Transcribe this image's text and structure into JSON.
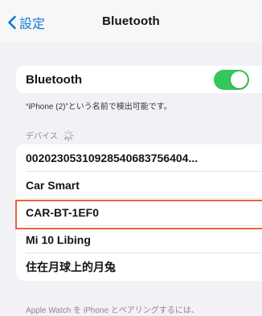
{
  "nav": {
    "back_label": "設定",
    "title": "Bluetooth"
  },
  "bluetooth": {
    "label": "Bluetooth",
    "enabled": true
  },
  "footnote": "“iPhone (2)”という名前で検出可能です。",
  "devices_header": "デバイス",
  "devices": [
    {
      "name": "002023053109285406837564​04..."
    },
    {
      "name": "Car Smart"
    },
    {
      "name": "CAR-BT-1EF0"
    },
    {
      "name": "Mi 10 Libing"
    },
    {
      "name": "住在月球上的月兔"
    }
  ],
  "bottom_note": "Apple Watch を iPhone とペアリングするには、",
  "colors": {
    "accent": "#1277d8",
    "toggle_on": "#34c759",
    "highlight": "#e8643c"
  }
}
